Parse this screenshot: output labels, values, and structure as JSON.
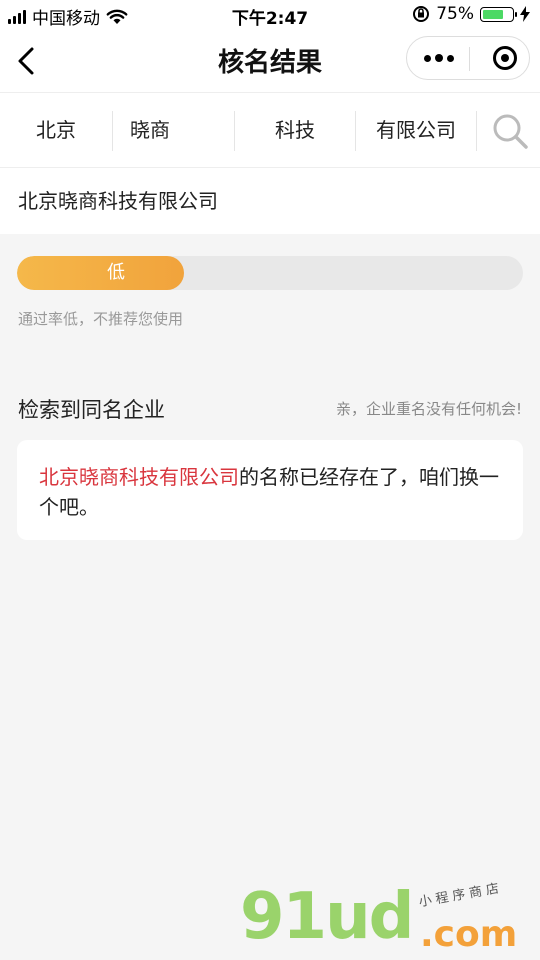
{
  "status_bar": {
    "carrier": "中国移动",
    "time": "下午2:47",
    "battery_percent": "75%",
    "battery_level": 0.75
  },
  "nav": {
    "title": "核名结果",
    "back_icon": "chevron-left-icon",
    "more_icon": "more-dots-icon",
    "close_icon": "target-icon"
  },
  "segments": [
    "北京",
    "晓商",
    "科技",
    "有限公司"
  ],
  "full_name": "北京晓商科技有限公司",
  "pass_rate": {
    "label": "低",
    "level": 0.33,
    "hint": "通过率低，不推荐您使用",
    "color": "#f1a33c"
  },
  "section": {
    "title": "检索到同名企业",
    "note": "亲，企业重名没有任何机会!"
  },
  "result_card": {
    "company": "北京晓商科技有限公司",
    "message": "的名称已经存在了，咱们换一个吧。"
  },
  "watermark": {
    "brand": "91ud",
    "tld": ".com",
    "tagline": "小程序商店"
  }
}
